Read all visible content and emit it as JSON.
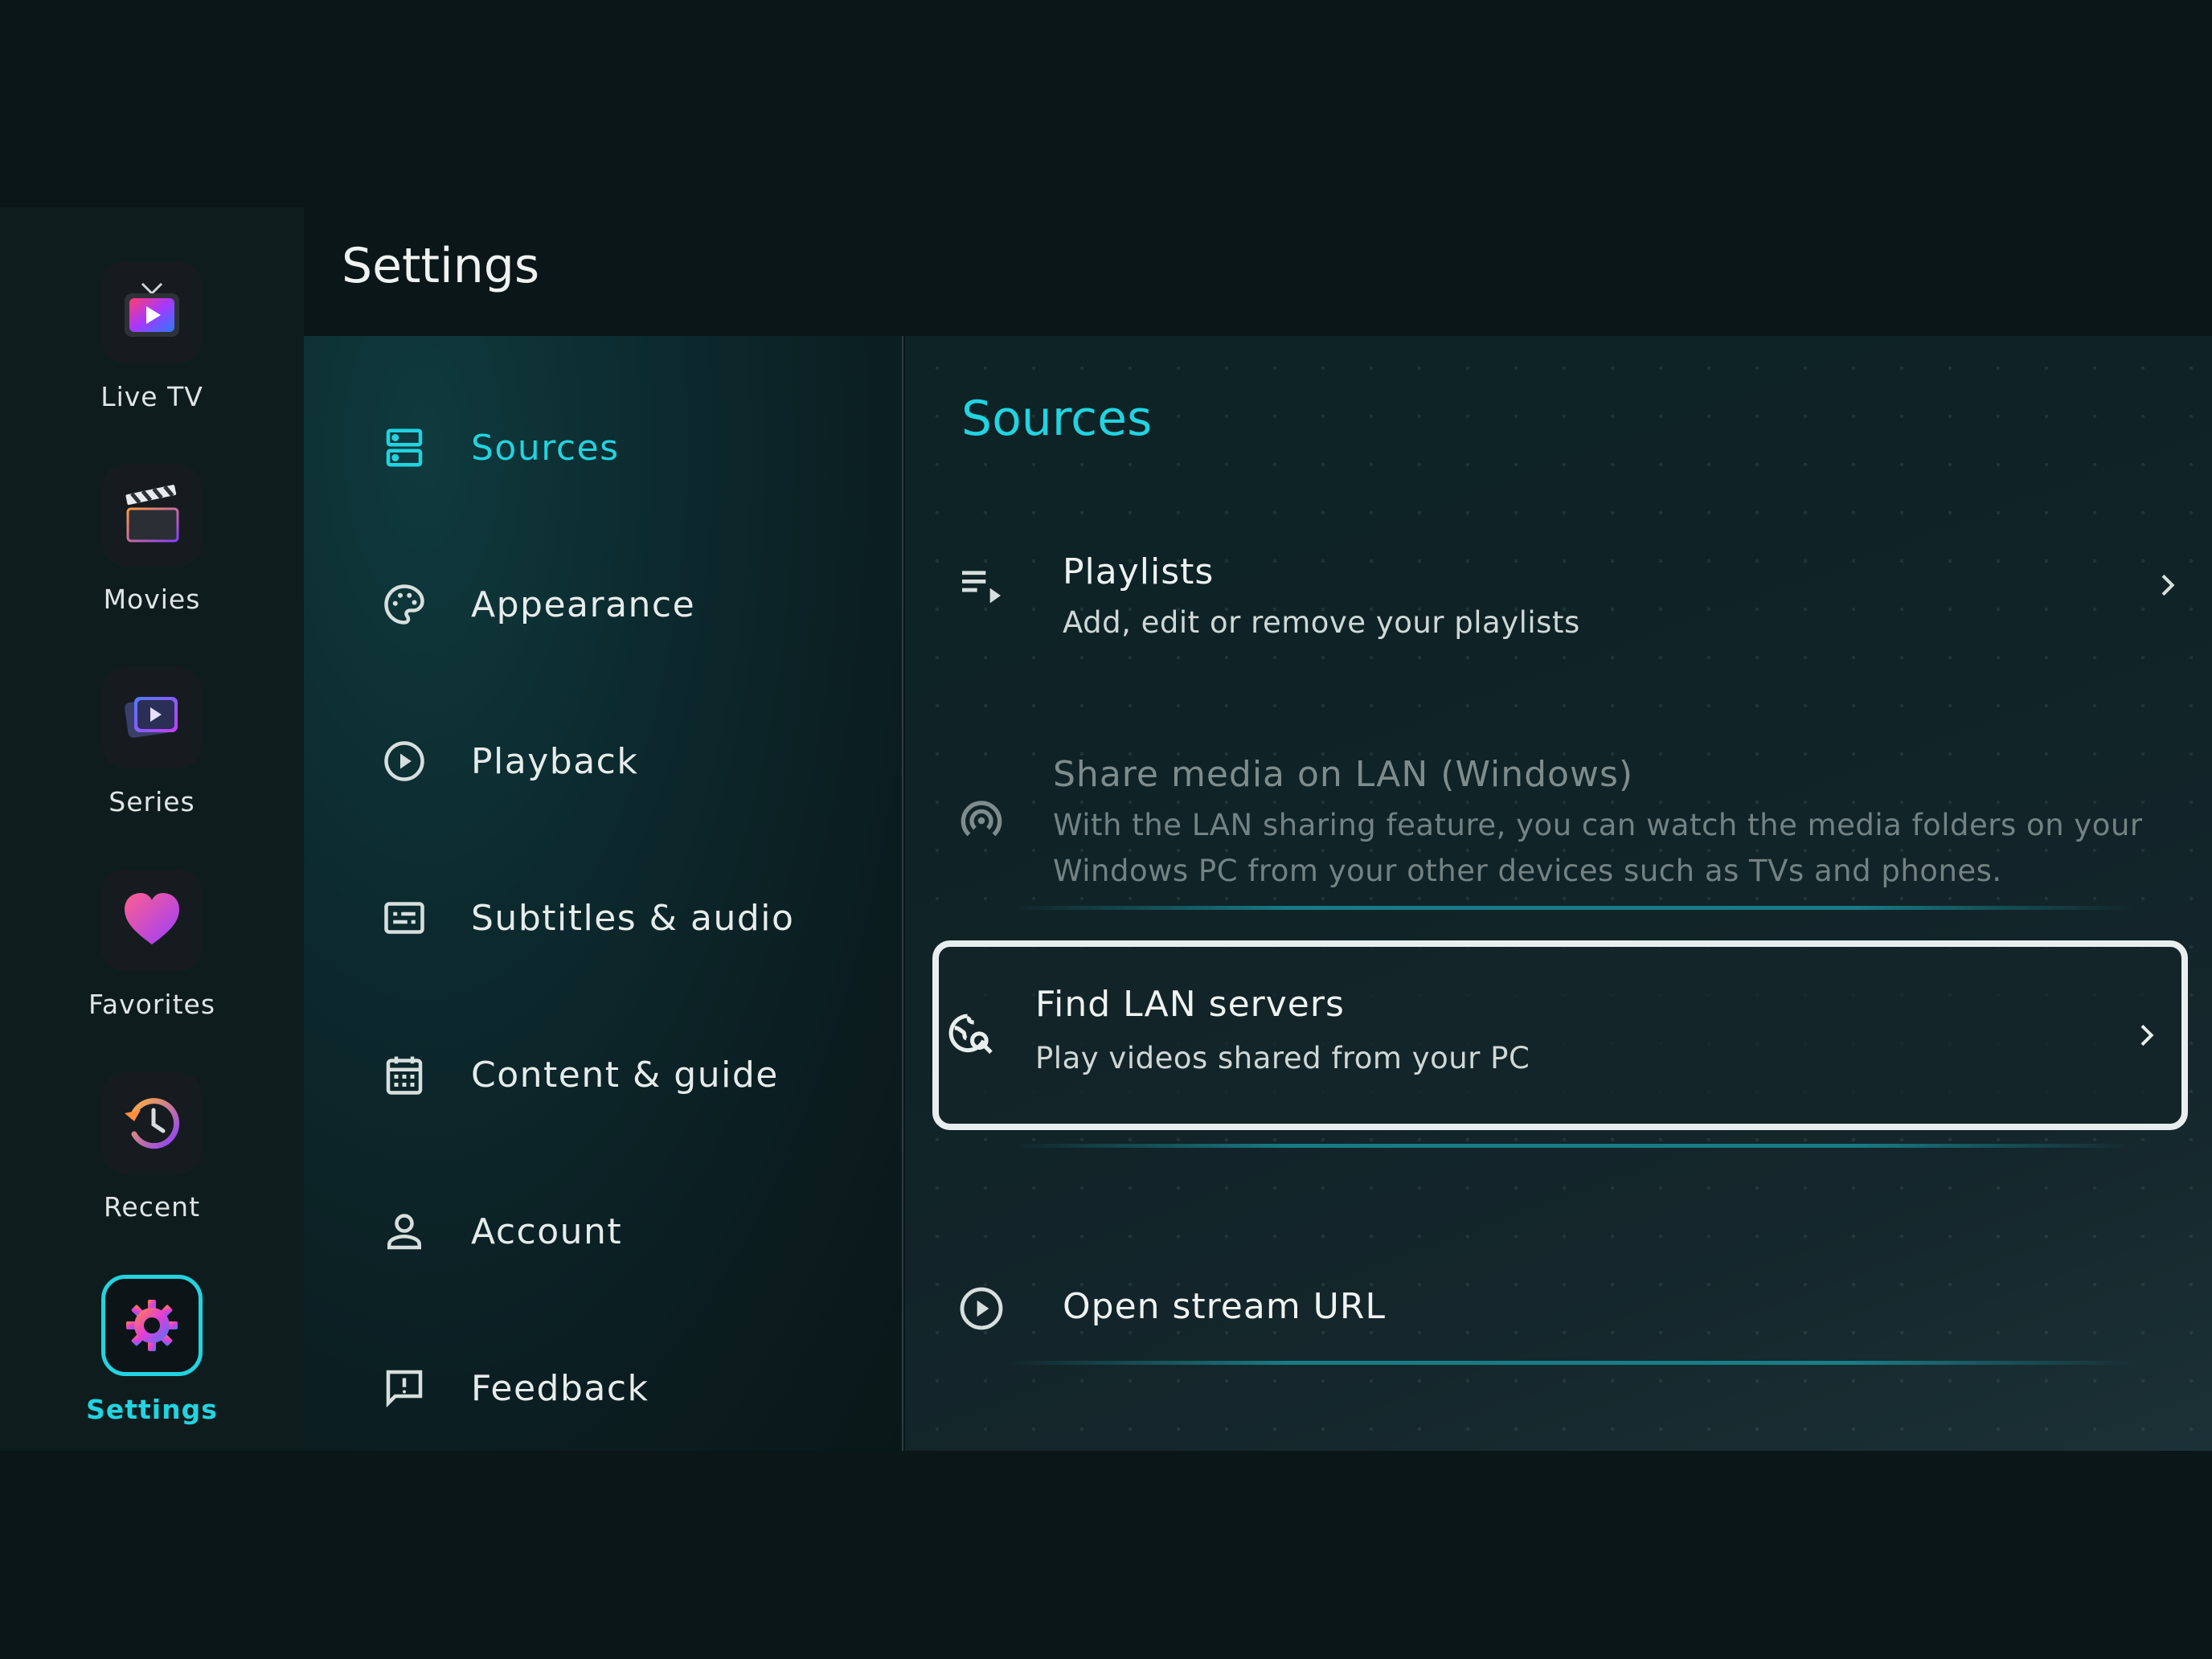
{
  "rail": {
    "items": [
      {
        "label": "Live TV",
        "icon": "live-tv-icon"
      },
      {
        "label": "Movies",
        "icon": "clapperboard-icon"
      },
      {
        "label": "Series",
        "icon": "series-icon"
      },
      {
        "label": "Favorites",
        "icon": "heart-icon"
      },
      {
        "label": "Recent",
        "icon": "history-icon"
      },
      {
        "label": "Settings",
        "icon": "gear-icon",
        "active": true
      }
    ]
  },
  "header": {
    "title": "Settings"
  },
  "categories": {
    "items": [
      {
        "label": "Sources",
        "icon": "dns-icon",
        "active": true
      },
      {
        "label": "Appearance",
        "icon": "palette-icon"
      },
      {
        "label": "Playback",
        "icon": "play-circle-icon"
      },
      {
        "label": "Subtitles & audio",
        "icon": "subtitles-icon"
      },
      {
        "label": "Content & guide",
        "icon": "calendar-icon"
      },
      {
        "label": "Account",
        "icon": "person-icon"
      },
      {
        "label": "Feedback",
        "icon": "feedback-icon"
      }
    ]
  },
  "detail": {
    "title": "Sources",
    "rows": [
      {
        "title": "Playlists",
        "subtitle": "Add, edit or remove your playlists",
        "icon": "playlist-play-icon"
      },
      {
        "title": "Share media on LAN (Windows)",
        "subtitle_lines": [
          "With the LAN sharing feature, you can watch the media folders on your",
          "Windows PC from your other devices such as TVs and phones."
        ],
        "icon": "wifi-tethering-icon",
        "disabled": true
      },
      {
        "title": "Find LAN servers",
        "subtitle": "Play videos shared from your PC",
        "icon": "travel-explore-icon",
        "focused": true
      },
      {
        "title": "Open stream URL",
        "icon": "play-circle-icon"
      }
    ]
  },
  "colors": {
    "accent": "#22d3e0",
    "background": "#0b1618",
    "rail": "#0f1c1e",
    "focus_border": "#e8eeee"
  }
}
